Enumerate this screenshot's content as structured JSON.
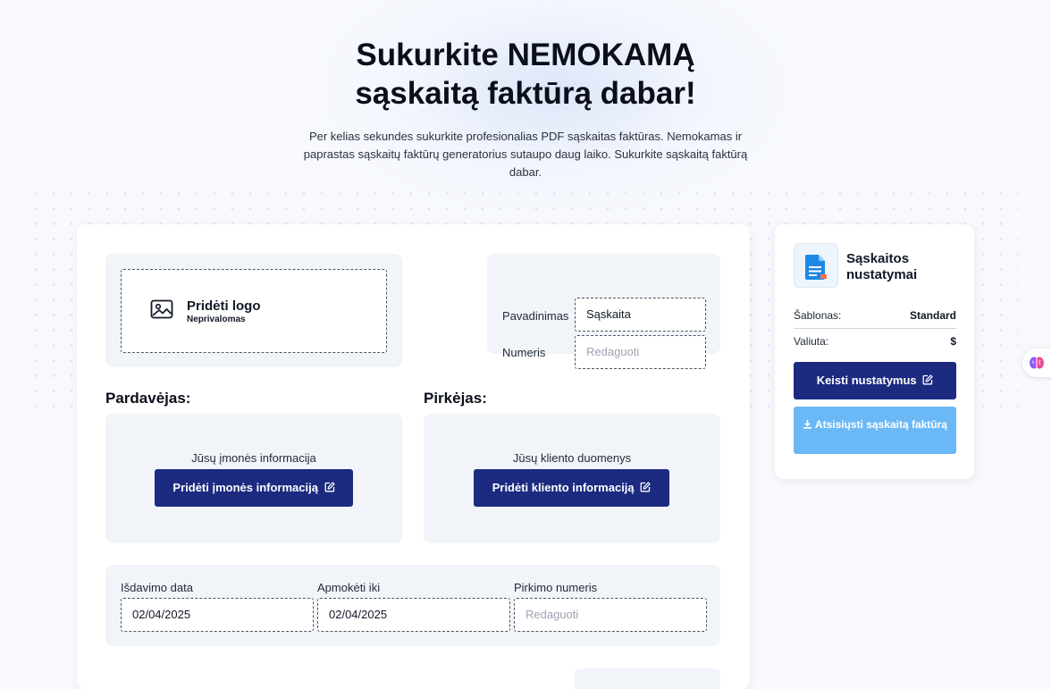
{
  "hero": {
    "title_line1": "Sukurkite NEMOKAMĄ",
    "title_line2": "sąskaitą faktūrą dabar!",
    "description": "Per kelias sekundes sukurkite profesionalias PDF sąskaitas faktūras. Nemokamas ir paprastas sąskaitų faktūrų generatorius sutaupo daug laiko. Sukurkite sąskaitą faktūrą dabar."
  },
  "logo": {
    "title": "Pridėti logo",
    "subtitle": "Neprivalomas",
    "icon": "image-icon"
  },
  "invoice_meta": {
    "name_label": "Pavadinimas",
    "name_value": "Sąskaita",
    "number_label": "Numeris",
    "number_placeholder": "Redaguoti"
  },
  "seller": {
    "heading": "Pardavėjas:",
    "info": "Jūsų įmonės informacija",
    "button": "Pridėti įmonės informaciją"
  },
  "buyer": {
    "heading": "Pirkėjas:",
    "info": "Jūsų kliento duomenys",
    "button": "Pridėti kliento informaciją"
  },
  "dates": {
    "issue_label": "Išdavimo data",
    "issue_value": "02/04/2025",
    "due_label": "Apmokėti iki",
    "due_value": "02/04/2025",
    "po_label": "Pirkimo numeris",
    "po_placeholder": "Redaguoti"
  },
  "settings": {
    "title": "Sąskaitos nustatymai",
    "template_label": "Šablonas:",
    "template_value": "Standard",
    "currency_label": "Valiuta:",
    "currency_value": "$",
    "edit_button": "Keisti nustatymus",
    "download_button": "Atsisiųsti sąskaitą faktūrą",
    "icon": "document-icon"
  },
  "colors": {
    "primary_button": "#1c2a80",
    "download_button": "#6ab8f6",
    "panel_bg": "#f1f4f8"
  }
}
